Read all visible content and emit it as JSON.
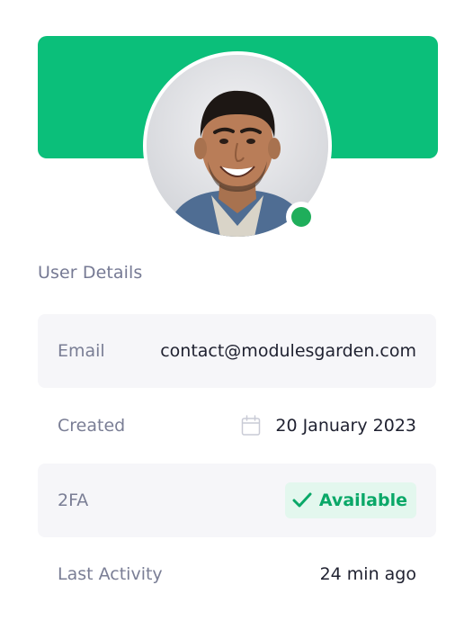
{
  "profile": {
    "banner_color": "#0bbf7a",
    "status_color": "#1fae5b",
    "status": "online"
  },
  "section": {
    "title": "User Details"
  },
  "details": {
    "email": {
      "label": "Email",
      "value": "contact@modulesgarden.com"
    },
    "created": {
      "label": "Created",
      "icon": "calendar-icon",
      "value": "20 January 2023"
    },
    "twofa": {
      "label": "2FA",
      "icon": "check-icon",
      "value": "Available"
    },
    "last_activity": {
      "label": "Last Activity",
      "value": "24 min ago"
    }
  }
}
